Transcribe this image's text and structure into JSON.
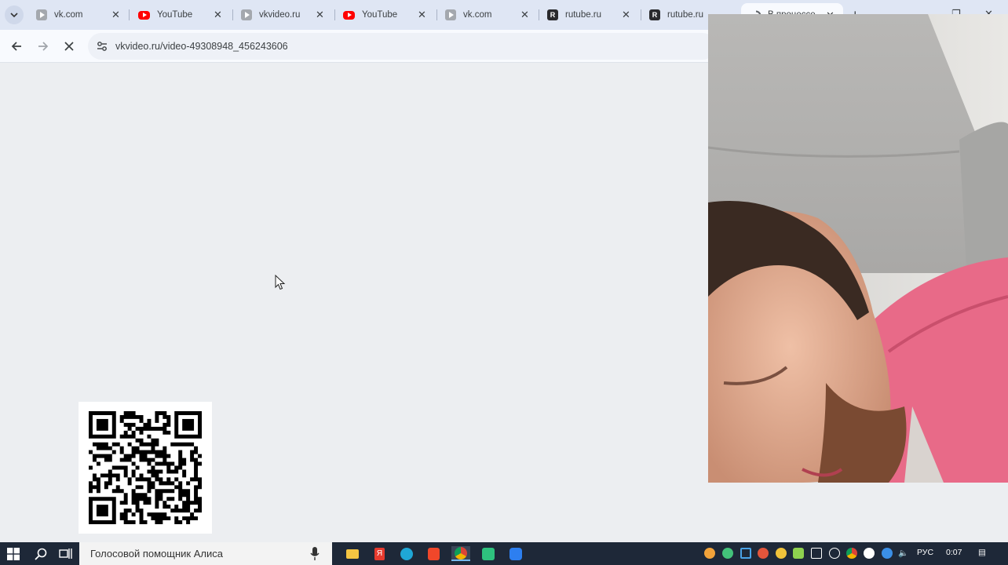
{
  "browser": {
    "tabs": [
      {
        "title": "vk.com",
        "favicon": "vk-video-icon"
      },
      {
        "title": "YouTube",
        "favicon": "youtube-icon"
      },
      {
        "title": "vkvideo.ru",
        "favicon": "vk-video-icon"
      },
      {
        "title": "YouTube",
        "favicon": "youtube-icon"
      },
      {
        "title": "vk.com",
        "favicon": "vk-video-icon"
      },
      {
        "title": "rutube.ru",
        "favicon": "rutube-icon"
      },
      {
        "title": "rutube.ru",
        "favicon": "rutube-icon"
      },
      {
        "title": "В процессе...",
        "favicon": "loading-icon",
        "active": true
      }
    ],
    "url": "vkvideo.ru/video-49308948_456243606"
  },
  "taskbar": {
    "search_placeholder": "Голосовой помощник Алиса",
    "language": "РУС",
    "time": "0:07"
  },
  "colors": {
    "tabstrip": "#dfe6f4",
    "toolbar": "#f8fafe",
    "page_background": "#eceef1",
    "taskbar": "#1e2838"
  }
}
